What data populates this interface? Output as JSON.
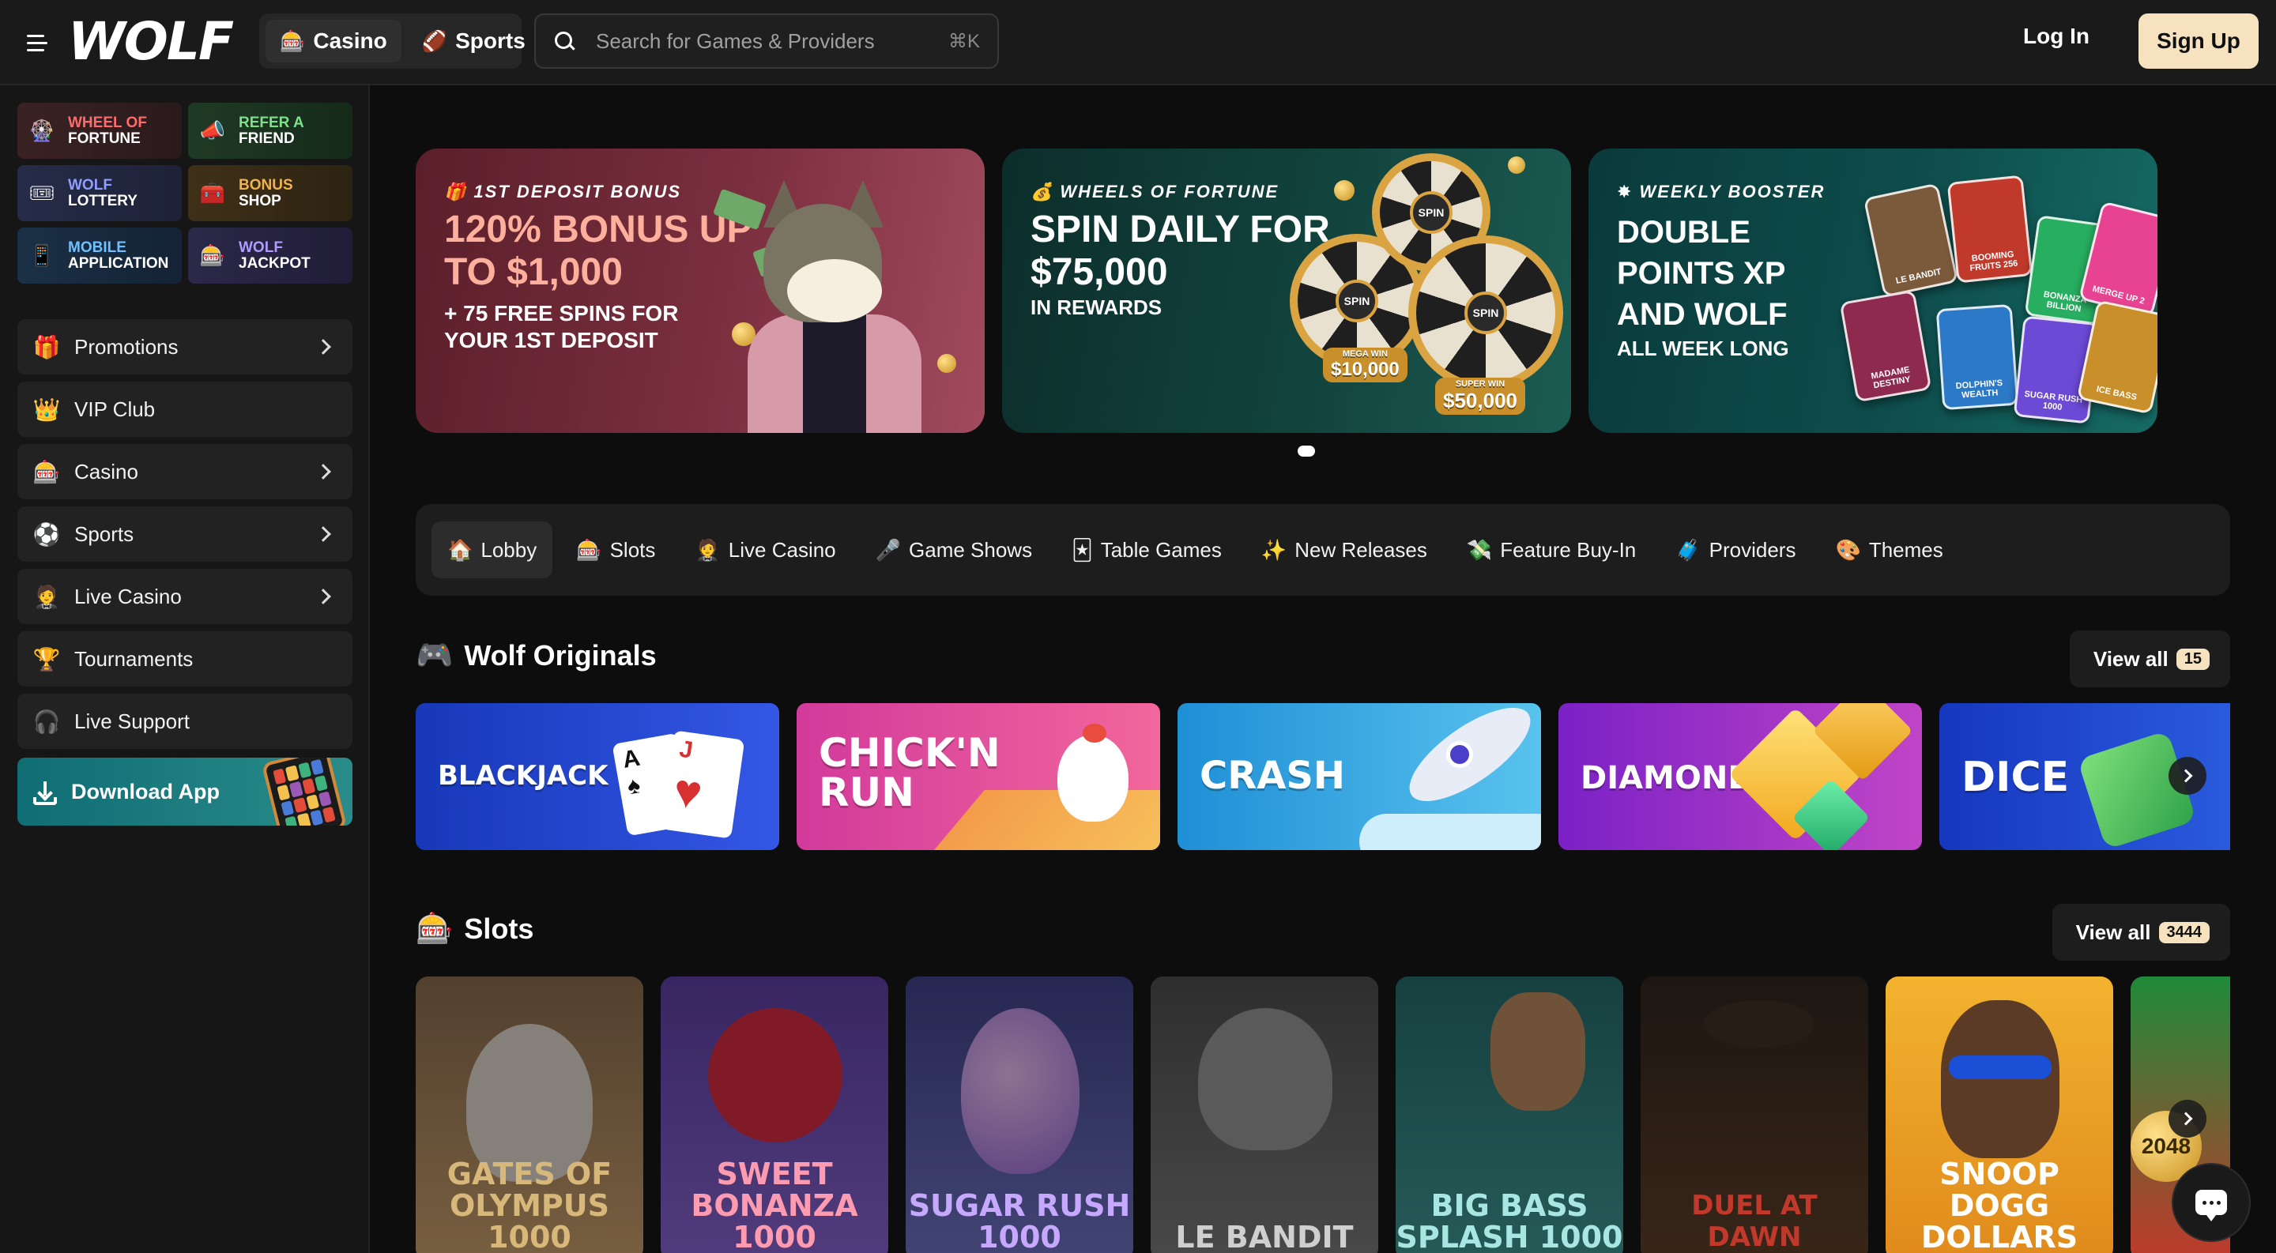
{
  "header": {
    "logo_text": "WOLF",
    "nav_tabs": [
      {
        "label": "Casino",
        "icon": "casino-icon"
      },
      {
        "label": "Sports",
        "icon": "football-icon"
      }
    ],
    "search_placeholder": "Search for Games & Providers",
    "search_shortcut": "⌘K",
    "login_label": "Log In",
    "signup_label": "Sign Up"
  },
  "sidebar": {
    "quick_links": [
      {
        "line1": "Wheel of",
        "line2": "Fortune",
        "icon": "wheel-icon"
      },
      {
        "line1": "Refer a",
        "line2": "Friend",
        "icon": "megaphone-icon"
      },
      {
        "line1": "Wolf",
        "line2": "Lottery",
        "icon": "lottery-icon"
      },
      {
        "line1": "Bonus",
        "line2": "Shop",
        "icon": "shop-icon"
      },
      {
        "line1": "Mobile",
        "line2": "Application",
        "icon": "phone-icon"
      },
      {
        "line1": "Wolf",
        "line2": "Jackpot",
        "icon": "jackpot-icon"
      }
    ],
    "menu": [
      {
        "label": "Promotions",
        "icon": "gift-icon",
        "has_chevron": true
      },
      {
        "label": "VIP Club",
        "icon": "crown-icon",
        "has_chevron": false
      },
      {
        "label": "Casino",
        "icon": "casino-icon",
        "has_chevron": true
      },
      {
        "label": "Sports",
        "icon": "soccer-ball-icon",
        "has_chevron": true
      },
      {
        "label": "Live Casino",
        "icon": "dealer-icon",
        "has_chevron": true
      },
      {
        "label": "Tournaments",
        "icon": "trophy-icon",
        "has_chevron": false
      },
      {
        "label": "Live Support",
        "icon": "headset-icon",
        "has_chevron": false
      }
    ],
    "download_label": "Download App"
  },
  "banners": [
    {
      "kicker": "1st Deposit Bonus",
      "headline": "120% BONUS UP TO $1,000",
      "sub": "+ 75 FREE SPINS FOR YOUR 1ST DEPOSIT"
    },
    {
      "kicker": "Wheels of Fortune",
      "headline": "SPIN DAILY FOR $75,000",
      "sub": "IN REWARDS",
      "wheel_hub": "SPIN",
      "mega_label": "MEGA WIN",
      "mega_value": "$10,000",
      "super_label": "SUPER WIN",
      "super_value": "$50,000"
    },
    {
      "kicker": "Weekly Booster",
      "headline": "DOUBLE POINTS XP AND WOLF",
      "sub": "ALL WEEK LONG",
      "cards": [
        "LE BANDIT",
        "BOOMING FRUITS 256",
        "BONANZA BILLION",
        "MERGE UP 2",
        "MADAME DESTINY",
        "DOLPHIN'S WEALTH",
        "SUGAR RUSH 1000",
        "ICE BASS"
      ]
    }
  ],
  "categories": [
    {
      "label": "Lobby",
      "icon": "home-icon",
      "active": true
    },
    {
      "label": "Slots",
      "icon": "slot-machine-icon",
      "active": false
    },
    {
      "label": "Live Casino",
      "icon": "dealer-icon",
      "active": false
    },
    {
      "label": "Game Shows",
      "icon": "microphone-icon",
      "active": false
    },
    {
      "label": "Table Games",
      "icon": "cards-icon",
      "active": false
    },
    {
      "label": "New Releases",
      "icon": "sparkle-icon",
      "active": false
    },
    {
      "label": "Feature Buy-In",
      "icon": "money-icon",
      "active": false
    },
    {
      "label": "Providers",
      "icon": "providers-icon",
      "active": false
    },
    {
      "label": "Themes",
      "icon": "themes-icon",
      "active": false
    }
  ],
  "originals": {
    "title": "Wolf Originals",
    "view_all": "View all",
    "count": "15",
    "games": [
      "BLACKJACK",
      "CHICK'N RUN",
      "CRASH",
      "DIAMONDS",
      "DICE"
    ]
  },
  "slots": {
    "title": "Slots",
    "view_all": "View all",
    "count": "3444",
    "games": [
      "GATES OF OLYMPUS 1000",
      "SWEET BONANZA 1000",
      "SUGAR RUSH 1000",
      "LE BANDIT",
      "BIG BASS SPLASH 1000",
      "DUEL AT DAWN",
      "SNOOP DOGG DOLLARS",
      "2048"
    ]
  },
  "colors": {
    "accent": "#f6e2bf",
    "background": "#0d0d0d",
    "panel": "#1d1d1d"
  }
}
